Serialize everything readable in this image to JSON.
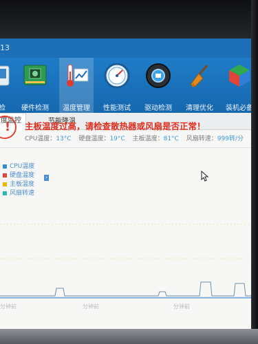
{
  "window": {
    "version": "13"
  },
  "toolbar": {
    "items": [
      {
        "label": "检",
        "icon": "partial-tool-icon"
      },
      {
        "label": "硬件检测",
        "icon": "motherboard-icon"
      },
      {
        "label": "温度管理",
        "icon": "thermometer-chart-icon",
        "active": true
      },
      {
        "label": "性能测试",
        "icon": "speedometer-icon"
      },
      {
        "label": "驱动检测",
        "icon": "driver-gear-icon"
      },
      {
        "label": "清理优化",
        "icon": "broom-icon"
      },
      {
        "label": "装机必备",
        "icon": "cube-box-icon"
      }
    ]
  },
  "tabs": {
    "monitor": "度监控",
    "energy": "节能降温"
  },
  "alert": {
    "title": "主板温度过高，请检查散热器或风扇是否正常！",
    "readings": [
      {
        "label": "CPU温度：",
        "value": "13°C"
      },
      {
        "label": "硬盘温度：",
        "value": "19°C"
      },
      {
        "label": "主板温度：",
        "value": "81°C"
      },
      {
        "label": "风扇转速：",
        "value": "999转/分"
      }
    ]
  },
  "legend": [
    {
      "label": "CPU温度",
      "color": "#3a87d4"
    },
    {
      "label": "硬盘温度",
      "color": "#e0453a"
    },
    {
      "label": "主板温度",
      "color": "#e7b800"
    },
    {
      "label": "风扇转速",
      "color": "#2fb8b0"
    }
  ],
  "chart_data": {
    "type": "line",
    "x_tick_labels": [
      "分钟前",
      "分钟前",
      "分钟前"
    ]
  }
}
